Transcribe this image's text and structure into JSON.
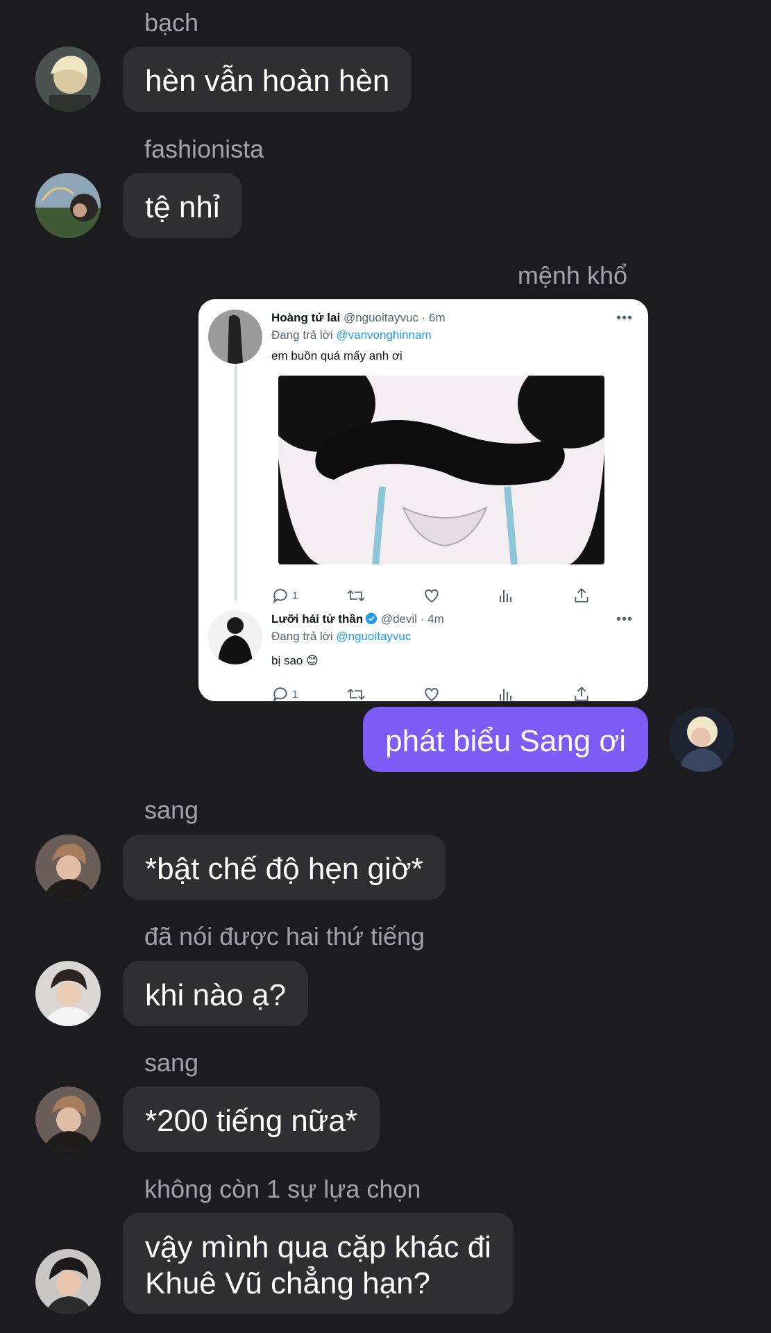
{
  "messages": [
    {
      "sender": "bạch",
      "text": "hèn vẫn hoàn hèn"
    },
    {
      "sender": "fashionista",
      "text": "tệ nhỉ"
    },
    {
      "sender": "mệnh khổ",
      "text": "phát biểu Sang ơi"
    },
    {
      "sender": "sang",
      "text": "*bật chế độ hẹn giờ*"
    },
    {
      "sender": "đã nói được hai thứ tiếng",
      "text": "khi nào ạ?"
    },
    {
      "sender": "sang",
      "text": "*200 tiếng nữa*"
    },
    {
      "sender": "không còn 1 sự lựa chọn",
      "text_line1": "vậy mình qua cặp khác đi",
      "text_line2": "Khuê Vũ chẳng hạn?"
    }
  ],
  "tweets": [
    {
      "name": "Hoàng tử lai",
      "handle_time": "@nguoitayvuc · 6m",
      "reply_prefix": "Đang trả lời",
      "reply_to": "@vanvonghinnam",
      "text": "em buồn quá mấy anh ơi",
      "reply_count": "1",
      "more": "•••"
    },
    {
      "name": "Lưỡi hái tử thần",
      "handle_time": "@devil · 4m",
      "reply_prefix": "Đang trả lời",
      "reply_to": "@nguoitayvuc",
      "text": "bị sao 😊",
      "reply_count": "1",
      "more": "•••"
    }
  ],
  "colors": {
    "background": "#1c1b1f",
    "bubble": "#2f2e33",
    "my_bubble": "#7c5cf5",
    "sender_text": "#a3a2a8",
    "mention": "#1d9bf0"
  },
  "icons": [
    "reply-icon",
    "retweet-icon",
    "like-icon",
    "views-icon",
    "share-icon",
    "verified-icon",
    "more-icon"
  ]
}
